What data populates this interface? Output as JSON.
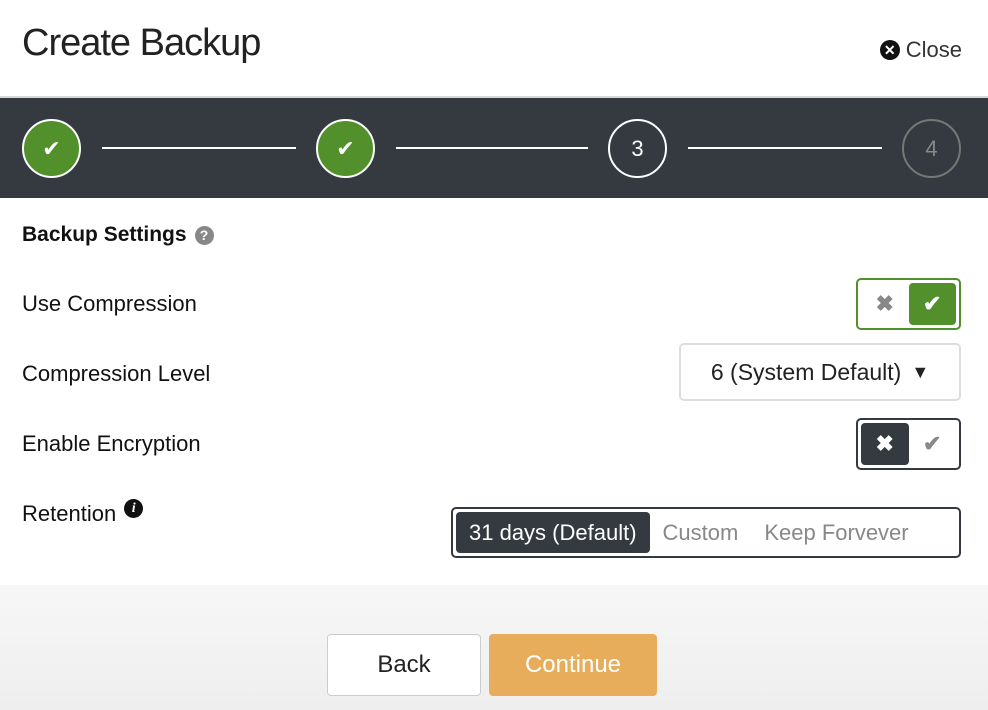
{
  "header": {
    "title": "Create Backup",
    "close_label": "Close"
  },
  "stepper": {
    "steps": [
      {
        "state": "done"
      },
      {
        "state": "done"
      },
      {
        "label": "3",
        "state": "current"
      },
      {
        "label": "4",
        "state": "future"
      }
    ]
  },
  "section": {
    "title": "Backup Settings"
  },
  "settings": {
    "use_compression": {
      "label": "Use Compression",
      "value": true
    },
    "compression_level": {
      "label": "Compression Level",
      "value": "6 (System Default)"
    },
    "enable_encryption": {
      "label": "Enable Encryption",
      "value": false
    },
    "retention": {
      "label": "Retention",
      "options": [
        "31 days (Default)",
        "Custom",
        "Keep Forvever"
      ],
      "selected": "31 days (Default)"
    }
  },
  "footer": {
    "back_label": "Back",
    "continue_label": "Continue"
  },
  "colors": {
    "accent_green": "#52902c",
    "dark": "#343a3f",
    "continue": "#e8ad5a"
  }
}
